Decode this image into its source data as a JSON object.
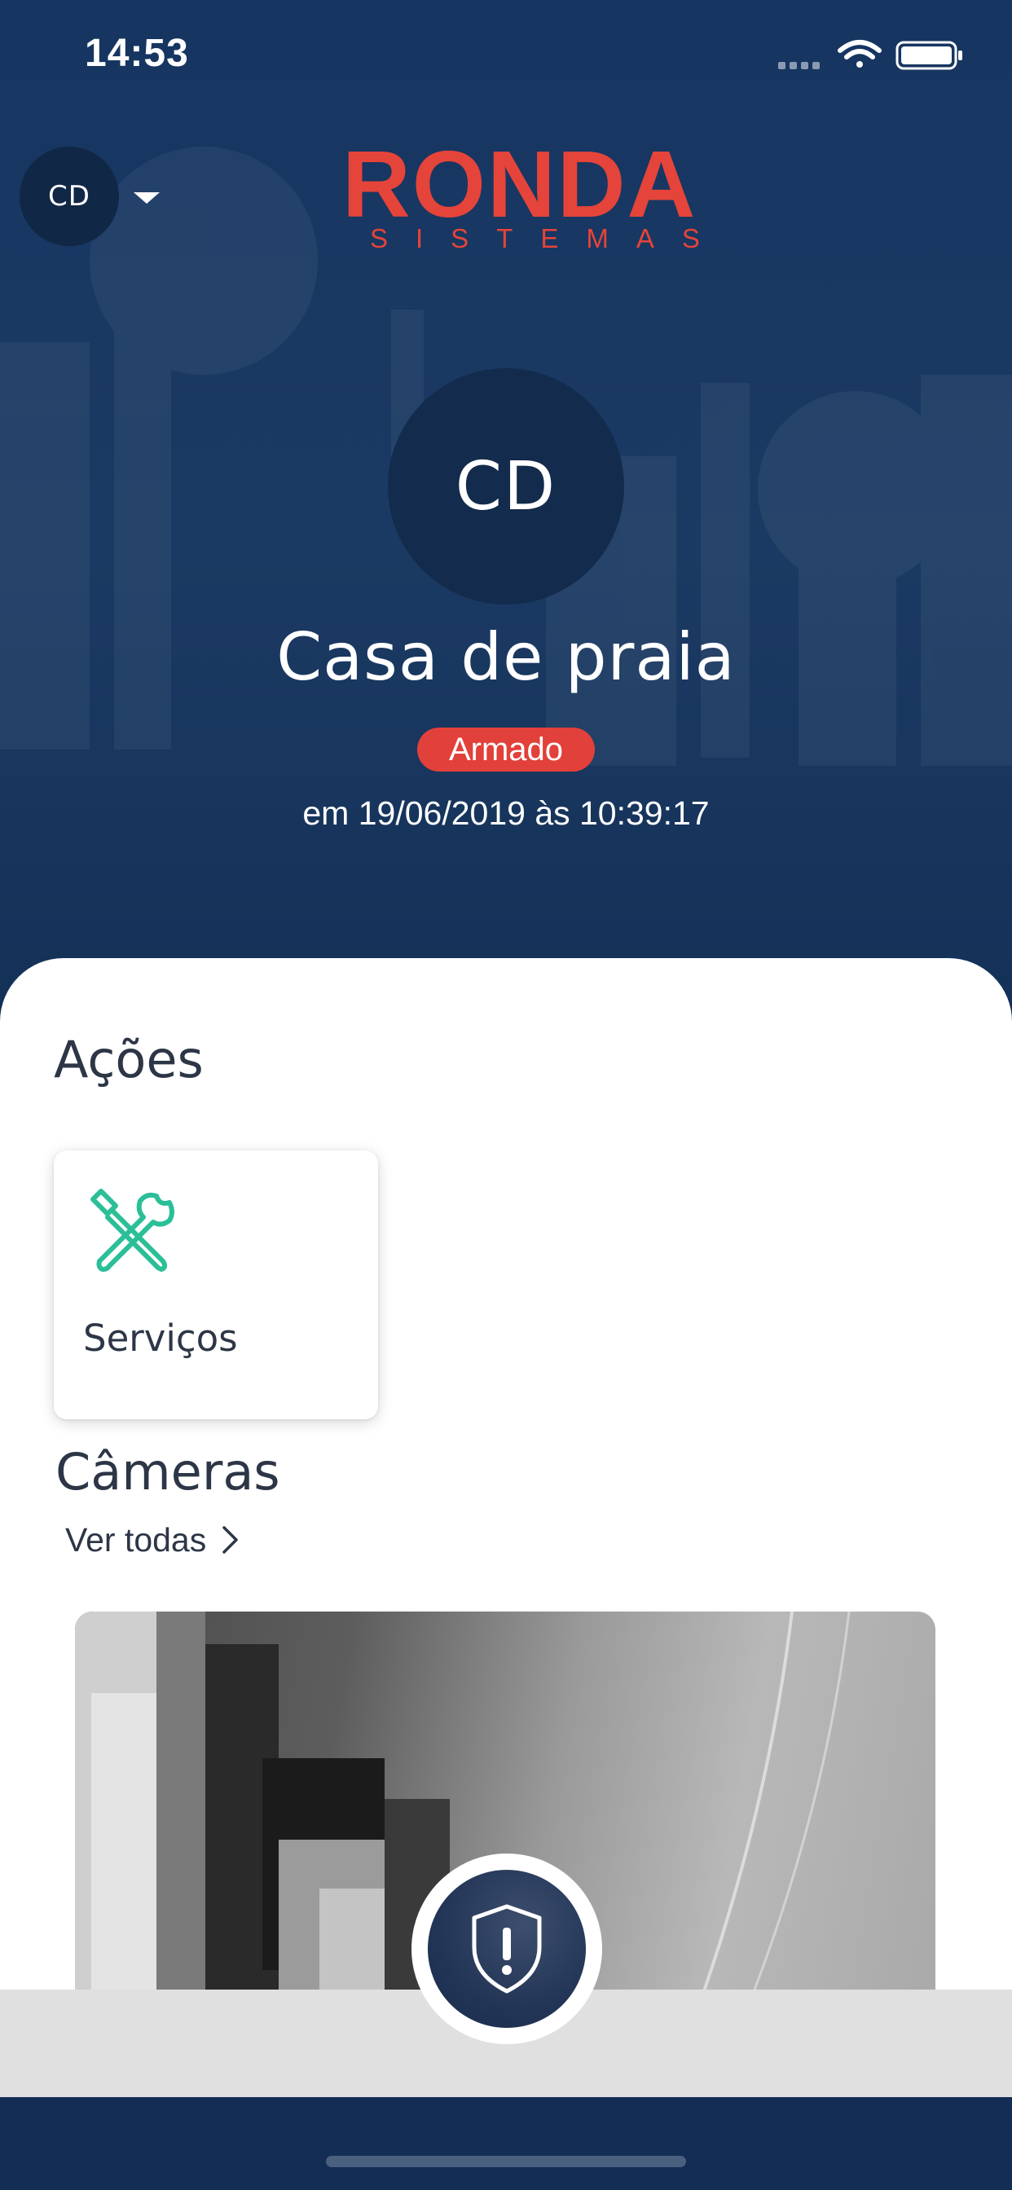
{
  "status_bar": {
    "time": "14:53"
  },
  "header": {
    "account_initials": "CD",
    "logo_main": "RONDA",
    "logo_sub": "SISTEMAS"
  },
  "site": {
    "initials": "CD",
    "name": "Casa de praia",
    "status": "Armado",
    "status_datetime": "em 19/06/2019 às 10:39:17"
  },
  "actions": {
    "title": "Ações",
    "items": [
      {
        "label": "Serviços",
        "icon": "tools-icon"
      }
    ]
  },
  "cameras": {
    "title": "Câmeras",
    "see_all": "Ver todas"
  },
  "colors": {
    "brand_navy": "#17355f",
    "brand_red": "#e5443a",
    "accent_green": "#2bbf98",
    "status_armed": "#e2403a"
  }
}
